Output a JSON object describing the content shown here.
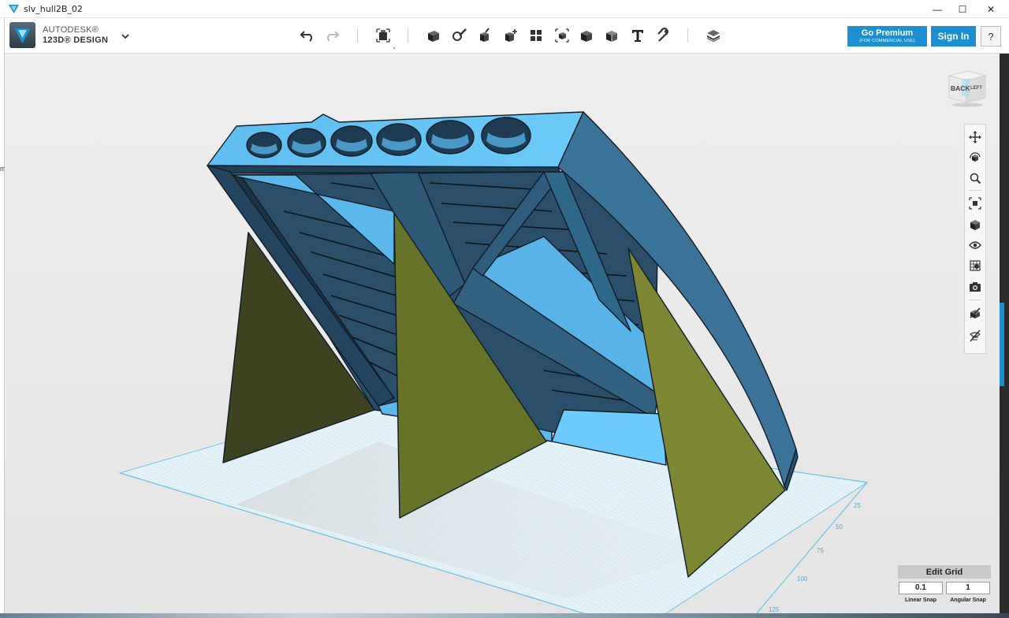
{
  "window": {
    "title": "slv_hull2B_02",
    "minimize_label": "—",
    "maximize_label": "☐",
    "close_label": "✕"
  },
  "brand": {
    "line1": "AUTODESK®",
    "line2": "123D® DESIGN",
    "logo_icon": "autodesk-123d-logo"
  },
  "toolbar": {
    "undo_icon": "undo-icon",
    "redo_icon": "redo-icon",
    "tools": [
      "transform-icon",
      "primitives-icon",
      "sketch-icon",
      "construct-icon",
      "modify-icon",
      "pattern-icon",
      "grouping-icon",
      "combine-icon",
      "measure-icon",
      "text-icon",
      "snap-icon",
      "material-icon"
    ],
    "go_premium_label": "Go Premium",
    "go_premium_sub": "(FOR COMMERCIAL USE)",
    "sign_in_label": "Sign In",
    "help_label": "?"
  },
  "viewcube": {
    "face_back": "BACK",
    "face_left": "LEFT"
  },
  "navbar": {
    "items": [
      "pan-icon",
      "orbit-icon",
      "zoom-icon",
      "fit-icon",
      "view-mode-icon",
      "visibility-icon",
      "materials-outline-icon",
      "camera-icon",
      "hide-sketch-icon",
      "hide-mesh-icon"
    ]
  },
  "grid_ruler": {
    "labels": [
      "25",
      "50",
      "75",
      "100",
      "125"
    ]
  },
  "grid": {
    "edit_label": "Edit Grid",
    "linear_snap_value": "0.1",
    "linear_snap_label": "Linear Snap",
    "angular_snap_value": "1",
    "angular_snap_label": "Angular Snap"
  },
  "colors": {
    "accent": "#1b8fcf",
    "model_top": "#5cb8ea",
    "model_side": "#2f6789",
    "panel_fill": "#6b6b2e",
    "grid_line": "#7ecbe6"
  },
  "left_edge_char": "m"
}
